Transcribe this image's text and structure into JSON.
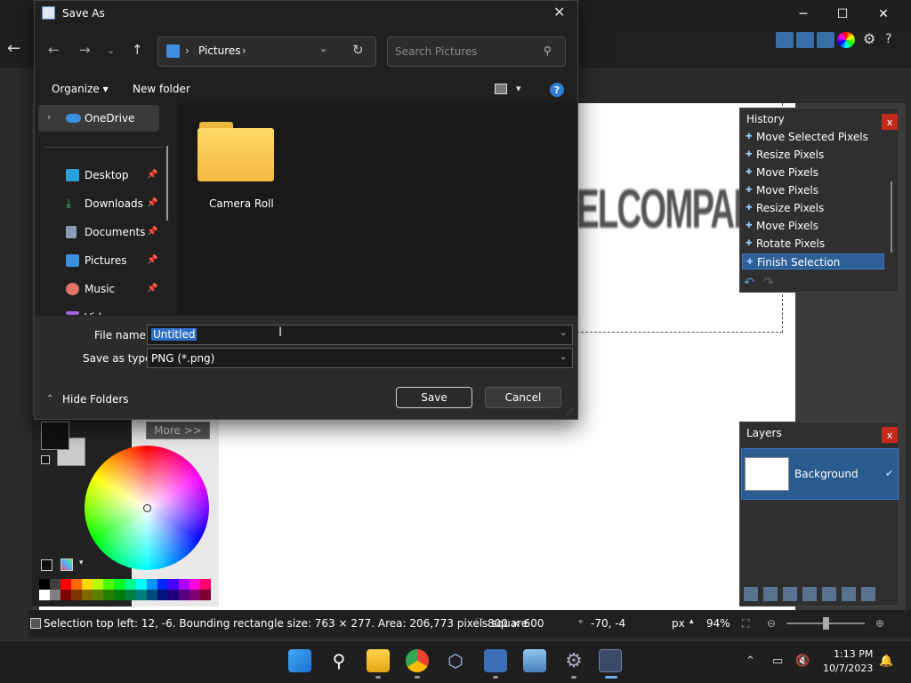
{
  "app": {
    "statusbar": {
      "selection_text": "Selection top left: 12, -6. Bounding rectangle size: 763 × 277. Area: 206,773 pixels square",
      "image_size": "800 × 600",
      "cursor_pos": "-70, -4",
      "units": "px",
      "zoom": "94%"
    },
    "canvas_text": "ELCOMPANY",
    "history": {
      "title": "History",
      "close": "x",
      "items": [
        "Move Selected Pixels",
        "Resize Pixels",
        "Move Pixels",
        "Move Pixels",
        "Resize Pixels",
        "Move Pixels",
        "Rotate Pixels",
        "Finish Selection"
      ],
      "selected_index": 7
    },
    "layers": {
      "title": "Layers",
      "close": "x",
      "layer_name": "Background",
      "layer_visible": true
    },
    "palette": {
      "more_label": "More >>",
      "swatches": [
        "#000000",
        "#404040",
        "#ff0000",
        "#ff6a00",
        "#ffd800",
        "#b6ff00",
        "#4cff00",
        "#00ff21",
        "#00ff90",
        "#00ffff",
        "#0094ff",
        "#0026ff",
        "#4800ff",
        "#b200ff",
        "#ff00dc",
        "#ff006e",
        "#ffffff",
        "#808080",
        "#7f0000",
        "#7f3300",
        "#7f6a00",
        "#5b7f00",
        "#267f00",
        "#007f0e",
        "#007f46",
        "#007f7f",
        "#004a7f",
        "#00137f",
        "#21007f",
        "#57007f",
        "#7f006e",
        "#7f0037"
      ]
    }
  },
  "dialog": {
    "title": "Save As",
    "address": {
      "location": "Pictures",
      "separator": "›"
    },
    "search_placeholder": "Search Pictures",
    "toolbar": {
      "organize": "Organize ▾",
      "new_folder": "New folder",
      "help": "?"
    },
    "nav_items": [
      {
        "label": "OneDrive",
        "icon": "onedrive-icon",
        "pinned": false
      },
      {
        "label": "Desktop",
        "icon": "desktop-icon",
        "pinned": true
      },
      {
        "label": "Downloads",
        "icon": "downloads-icon",
        "pinned": true
      },
      {
        "label": "Documents",
        "icon": "documents-icon",
        "pinned": true
      },
      {
        "label": "Pictures",
        "icon": "pictures-icon",
        "pinned": true
      },
      {
        "label": "Music",
        "icon": "music-icon",
        "pinned": true
      },
      {
        "label": "Videos",
        "icon": "videos-icon",
        "pinned": true
      }
    ],
    "folders": [
      {
        "label": "Camera Roll"
      }
    ],
    "file_name_label": "File name:",
    "file_name_value": "Untitled",
    "save_type_label": "Save as type:",
    "save_type_value": "PNG (*.png)",
    "hide_folders": "Hide Folders",
    "save_button": "Save",
    "cancel_button": "Cancel"
  },
  "taskbar": {
    "time": "1:13 PM",
    "date": "10/7/2023",
    "apps": [
      "start-icon",
      "search-icon",
      "file-explorer-icon",
      "chrome-icon",
      "virtualbox-icon",
      "paintnet-alt-icon",
      "photos-icon",
      "settings-icon",
      "paintnet-icon"
    ]
  }
}
